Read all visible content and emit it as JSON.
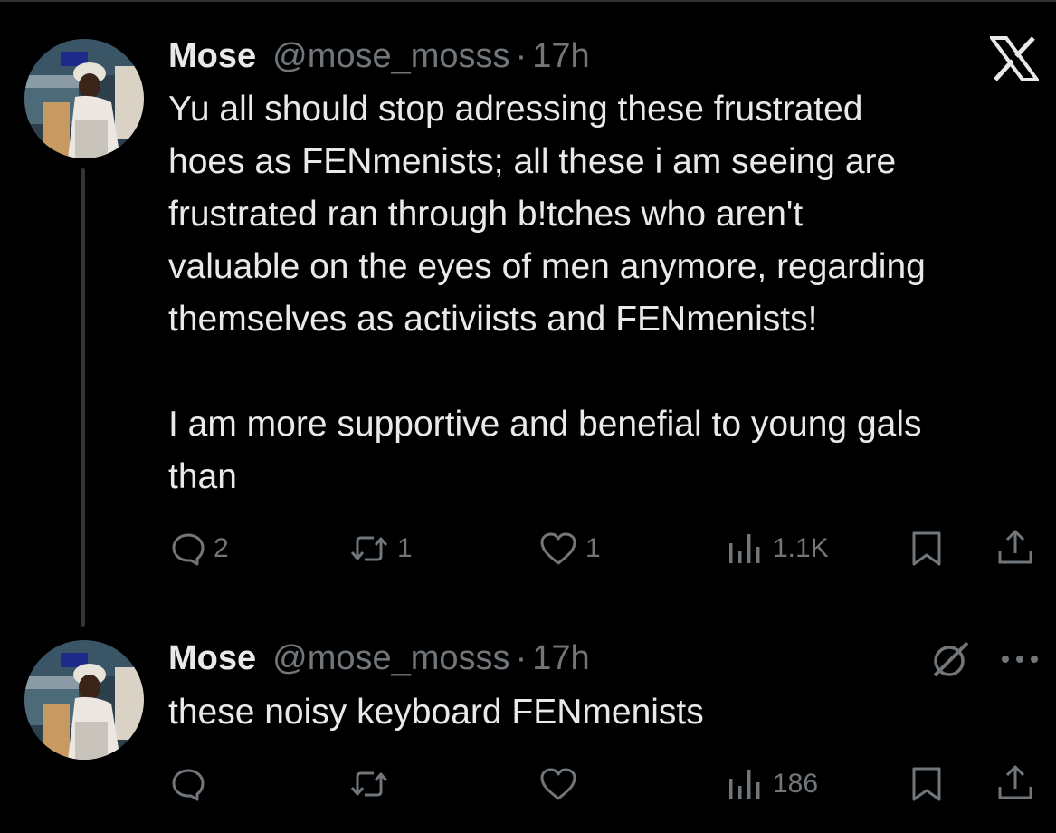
{
  "brand": {
    "logo_icon": "x-logo-icon"
  },
  "colors": {
    "background": "#000000",
    "text": "#e7e9ea",
    "muted": "#71767b",
    "thread_line": "#333639"
  },
  "tweets": [
    {
      "name": "Mose",
      "handle": "@mose_mosss",
      "separator": "·",
      "time": "17h",
      "paragraphs": [
        [
          "Yu all should stop adressing these frustrated",
          "hoes as FENmenists; all these i am seeing are",
          "frustrated ran through b!tches who aren't",
          "valuable on the eyes of men anymore, regarding",
          "themselves as activiists and FENmenists!"
        ],
        [
          "I am more supportive and benefial to young gals",
          "than"
        ]
      ],
      "actions": {
        "replies": "2",
        "reposts": "1",
        "likes": "1",
        "views": "1.1K"
      }
    },
    {
      "name": "Mose",
      "handle": "@mose_mosss",
      "separator": "·",
      "time": "17h",
      "paragraphs": [
        [
          "these noisy keyboard FENmenists"
        ]
      ],
      "actions": {
        "replies": "",
        "reposts": "",
        "likes": "",
        "views": "186"
      }
    }
  ]
}
